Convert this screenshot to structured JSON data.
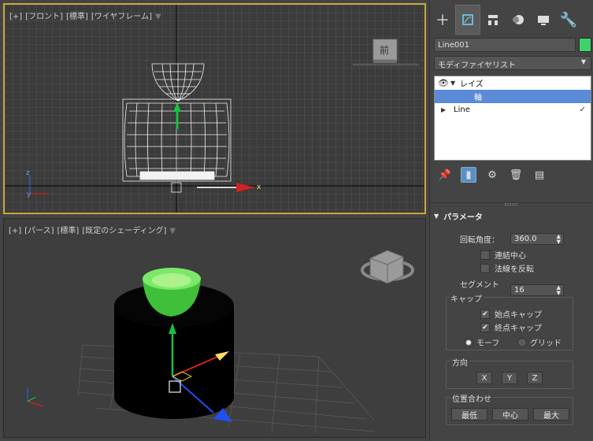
{
  "viewport_front": {
    "label": [
      "[+]",
      "[フロント]",
      "[標準]",
      "[ワイヤフレーム]"
    ],
    "viewcube_label": "前",
    "axis_x": "x",
    "axis_y": "y",
    "axis_z": "z"
  },
  "viewport_persp": {
    "label": [
      "[+]",
      "[パース]",
      "[標準]",
      "[既定のシェーディング]"
    ]
  },
  "panel": {
    "object_name": "Line001",
    "object_color": "#3dd36a",
    "modifier_list": "モディファイヤリスト",
    "stack": [
      {
        "label": "レイズ",
        "selected": false,
        "level": 0
      },
      {
        "label": "軸",
        "selected": true,
        "level": 1
      },
      {
        "label": "Line",
        "selected": false,
        "level": 0
      }
    ],
    "parameters": {
      "title": "パラメータ",
      "rotation_label": "回転角度：",
      "rotation_value": "360.0",
      "weld_core": "連結中心",
      "flip_normals": "法線を反転",
      "segments_label": "セグメント数：",
      "segments_value": "16",
      "capping": {
        "title": "キャップ",
        "cap_start": "始点キャップ",
        "cap_end": "終点キャップ",
        "morph": "モーフ",
        "grid": "グリッド"
      },
      "direction": {
        "title": "方向",
        "x": "X",
        "y": "Y",
        "z": "Z"
      },
      "align": {
        "title": "位置合わせ",
        "min": "最低",
        "center": "中心",
        "max": "最大"
      }
    }
  }
}
